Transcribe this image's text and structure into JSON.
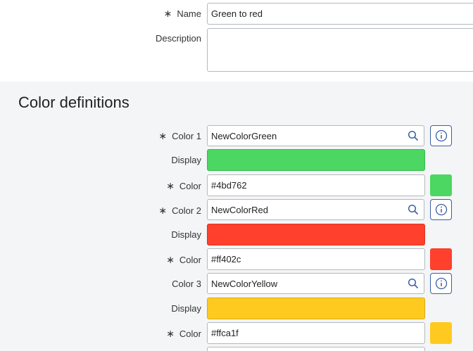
{
  "form": {
    "name_label": "Name",
    "name_value": "Green to red",
    "description_label": "Description",
    "description_value": "",
    "required_marker": "∗"
  },
  "section": {
    "title": "Color definitions"
  },
  "colors": [
    {
      "label": "Color 1",
      "required": true,
      "ref_value": "NewColorGreen",
      "display_label": "Display",
      "color_label": "Color",
      "hex": "#4bd762"
    },
    {
      "label": "Color 2",
      "required": true,
      "ref_value": "NewColorRed",
      "display_label": "Display",
      "color_label": "Color",
      "hex": "#ff402c"
    },
    {
      "label": "Color 3",
      "required": false,
      "ref_value": "NewColorYellow",
      "display_label": "Display",
      "color_label": "Color",
      "hex": "#ffca1f"
    }
  ],
  "icons": {
    "search": "search-icon",
    "info": "info-icon"
  }
}
